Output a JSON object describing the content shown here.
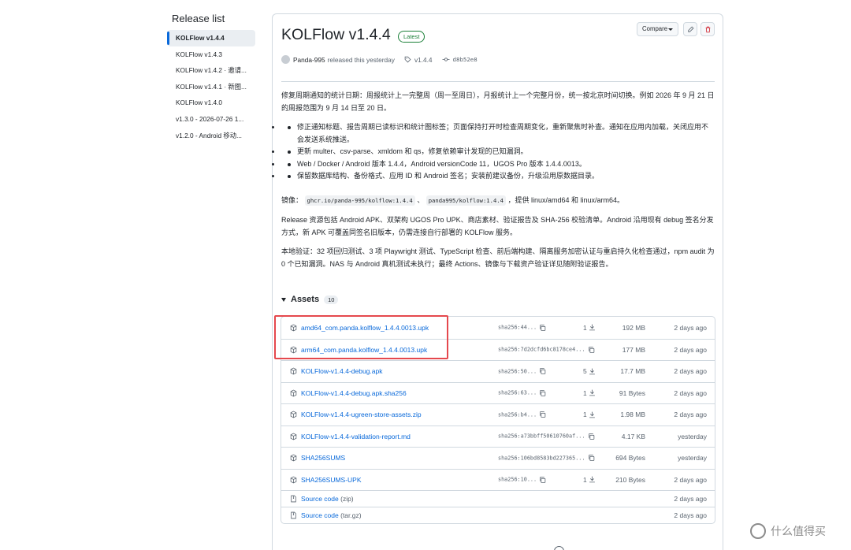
{
  "sidebar": {
    "title": "Release list",
    "items": [
      {
        "label": "KOLFlow v1.4.4"
      },
      {
        "label": "KOLFlow v1.4.3"
      },
      {
        "label": "KOLFlow v1.4.2 · 邀请..."
      },
      {
        "label": "KOLFlow v1.4.1 · 新图..."
      },
      {
        "label": "KOLFlow v1.4.0"
      },
      {
        "label": "v1.3.0 - 2026-07-26 1..."
      },
      {
        "label": "v1.2.0 - Android 移动..."
      }
    ]
  },
  "release": {
    "title": "KOLFlow v1.4.4",
    "badge": "Latest",
    "compare_label": "Compare",
    "author": "Panda-995",
    "released_text": "released this yesterday",
    "tag": "v1.4.4",
    "commit": "d8b52e8"
  },
  "notes": {
    "intro": "修复周期通知的统计日期：周报统计上一完整周（周一至周日），月报统计上一个完整月份，统一按北京时间切换。例如 2026 年 9 月 21 日的周报范围为 9 月 14 日至 20 日。",
    "bullets": [
      "修正通知标题、报告周期已读标识和统计图标签；页面保持打开时检查周期变化，重新聚焦时补查。通知在应用内加载，关闭应用不会发送系统推送。",
      "更新 multer、csv-parse、xmldom 和 qs，修复依赖审计发现的已知漏洞。",
      "Web / Docker / Android 版本 1.4.4，Android versionCode 11，UGOS Pro 版本 1.4.4.0013。",
      "保留数据库结构、备份格式、应用 ID 和 Android 签名；安装前建议备份，升级沿用原数据目录。"
    ],
    "mirror_prefix": "镜像：",
    "mirror_code1": "ghcr.io/panda-995/kolflow:1.4.4",
    "mirror_sep": "、",
    "mirror_code2": "panda995/kolflow:1.4.4",
    "mirror_suffix": "，提供 linux/amd64 和 linux/arm64。",
    "assets_para": "Release 资源包括 Android APK、双架构 UGOS Pro UPK、商店素材、验证报告及 SHA-256 校验清单。Android 沿用现有 debug 签名分发方式，新 APK 可覆盖同签名旧版本，仍需连接自行部署的 KOLFlow 服务。",
    "verify_para": "本地验证：32 项回归测试、3 项 Playwright 测试、TypeScript 检查、前后端构建、隔离服务加密认证与重启持久化检查通过，npm audit 为 0 个已知漏洞。NAS 与 Android 真机测试未执行；最终 Actions、镜像与下载资产验证详见随附验证报告。"
  },
  "assets": {
    "heading": "Assets",
    "count": "10",
    "rows": [
      {
        "name": "amd64_com.panda.kolflow_1.4.4.0013.upk",
        "sha": "sha256:44...",
        "downloads": "1",
        "size": "192 MB",
        "date": "2 days ago"
      },
      {
        "name": "arm64_com.panda.kolflow_1.4.4.0013.upk",
        "sha": "sha256:7d2dcfd6bc8178ce4...",
        "downloads": "",
        "size": "177 MB",
        "date": "2 days ago"
      },
      {
        "name": "KOLFlow-v1.4.4-debug.apk",
        "sha": "sha256:50...",
        "downloads": "5",
        "size": "17.7 MB",
        "date": "2 days ago"
      },
      {
        "name": "KOLFlow-v1.4.4-debug.apk.sha256",
        "sha": "sha256:63...",
        "downloads": "1",
        "size": "91 Bytes",
        "date": "2 days ago"
      },
      {
        "name": "KOLFlow-v1.4.4-ugreen-store-assets.zip",
        "sha": "sha256:b4...",
        "downloads": "1",
        "size": "1.98 MB",
        "date": "2 days ago"
      },
      {
        "name": "KOLFlow-v1.4.4-validation-report.md",
        "sha": "sha256:a73bbff50610760af...",
        "downloads": "",
        "size": "4.17 KB",
        "date": "yesterday"
      },
      {
        "name": "SHA256SUMS",
        "sha": "sha256:106bd8583bd227365...",
        "downloads": "",
        "size": "694 Bytes",
        "date": "yesterday"
      },
      {
        "name": "SHA256SUMS-UPK",
        "sha": "sha256:10...",
        "downloads": "1",
        "size": "210 Bytes",
        "date": "2 days ago"
      }
    ],
    "source_rows": [
      {
        "label": "Source code",
        "paren": "(zip)",
        "date": "2 days ago"
      },
      {
        "label": "Source code",
        "paren": "(tar.gz)",
        "date": "2 days ago"
      }
    ]
  },
  "watermark": "什么值得买",
  "colors": {
    "link": "#0969da",
    "latest": "#1a7f37",
    "highlight": "#e5484d",
    "delete": "#cf222e"
  }
}
